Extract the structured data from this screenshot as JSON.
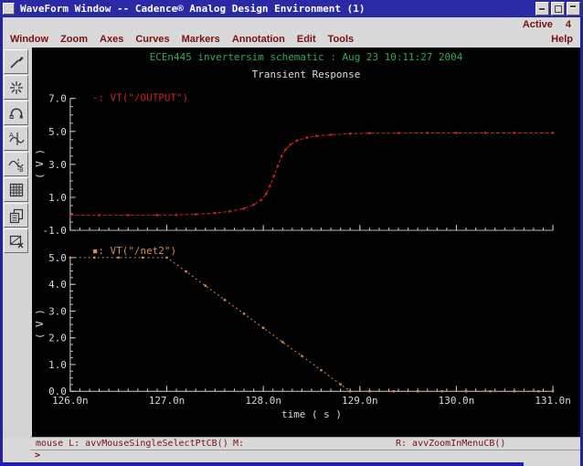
{
  "window": {
    "title": "WaveForm Window -- Cadence® Analog Design Environment (1)",
    "active_label": "Active",
    "active_count": "4"
  },
  "menu": {
    "items": [
      "Window",
      "Zoom",
      "Axes",
      "Curves",
      "Markers",
      "Annotation",
      "Edit",
      "Tools"
    ],
    "help": "Help"
  },
  "toolbar": {
    "icons": [
      "annotate-pen",
      "zoom-fit",
      "undo",
      "vertical-marker-a",
      "horizontal-marker-b",
      "calculator",
      "copy-graph",
      "slice-graph"
    ]
  },
  "status": {
    "mouse_left": "mouse L: avvMouseSingleSelectPtCB()",
    "mouse_middle": "M:",
    "mouse_right": "R: avvZoomInMenuCB()",
    "prompt": ">"
  },
  "colors": {
    "titlebar": "#2a2aa6",
    "menu_text": "#7a1010",
    "header_green": "#33a855",
    "axis_white": "#cccccc",
    "output_trace": "#cc2222",
    "net2_trace": "#d88a5a"
  },
  "chart_data": {
    "type": "line",
    "header": "ECEn445 invertersim schematic : Aug 23 10:11:27 2004",
    "title": "Transient Response",
    "xlabel": "time ( s )",
    "x_range_ns": [
      126,
      131
    ],
    "x_minor_step_ns": 0.1,
    "x_ticks": [
      {
        "v": 126,
        "label": "126.0n"
      },
      {
        "v": 127,
        "label": "127.0n"
      },
      {
        "v": 128,
        "label": "128.0n"
      },
      {
        "v": 129,
        "label": "129.0n"
      },
      {
        "v": 130,
        "label": "130.0n"
      },
      {
        "v": 131,
        "label": "131.0n"
      }
    ],
    "grid": false,
    "legend_position": "top-left-inside",
    "plots": [
      {
        "id": "top",
        "legend": "-: VT(\"/OUTPUT\")",
        "color": "#cc2222",
        "dash": "4 2",
        "ylabel": "( V )",
        "ylim": [
          -1.0,
          7.0
        ],
        "y_minor_step": 0.5,
        "yticks": [
          {
            "v": 7.0,
            "label": "7.0"
          },
          {
            "v": 5.0,
            "label": "5.0"
          },
          {
            "v": 3.0,
            "label": "3.0"
          },
          {
            "v": 1.0,
            "label": "1.0"
          },
          {
            "v": -1.0,
            "label": "-1.0"
          }
        ],
        "x_labeled": false,
        "series": {
          "name": "VT(\"/OUTPUT\")",
          "points": [
            [
              126.0,
              -0.08
            ],
            [
              126.3,
              -0.08
            ],
            [
              126.6,
              -0.08
            ],
            [
              126.9,
              -0.08
            ],
            [
              127.1,
              -0.07
            ],
            [
              127.3,
              -0.03
            ],
            [
              127.5,
              0.05
            ],
            [
              127.65,
              0.15
            ],
            [
              127.8,
              0.32
            ],
            [
              127.9,
              0.55
            ],
            [
              127.98,
              0.85
            ],
            [
              128.03,
              1.2
            ],
            [
              128.07,
              1.7
            ],
            [
              128.11,
              2.3
            ],
            [
              128.15,
              2.9
            ],
            [
              128.19,
              3.5
            ],
            [
              128.23,
              3.9
            ],
            [
              128.28,
              4.2
            ],
            [
              128.35,
              4.45
            ],
            [
              128.45,
              4.62
            ],
            [
              128.55,
              4.72
            ],
            [
              128.7,
              4.8
            ],
            [
              128.9,
              4.86
            ],
            [
              129.1,
              4.89
            ],
            [
              129.4,
              4.9
            ],
            [
              129.7,
              4.91
            ],
            [
              130.0,
              4.91
            ],
            [
              130.3,
              4.91
            ],
            [
              130.6,
              4.91
            ],
            [
              131.0,
              4.91
            ]
          ]
        }
      },
      {
        "id": "bottom",
        "legend": "▪: VT(\"/net2\")",
        "color": "#d88a5a",
        "dash": "2 3",
        "ylabel": "( V )",
        "ylim": [
          0.0,
          5.0
        ],
        "y_minor_step": 0.25,
        "yticks": [
          {
            "v": 5.0,
            "label": "5.0"
          },
          {
            "v": 4.0,
            "label": "4.0"
          },
          {
            "v": 3.0,
            "label": "3.0"
          },
          {
            "v": 2.0,
            "label": "2.0"
          },
          {
            "v": 1.0,
            "label": "1.0"
          },
          {
            "v": 0.0,
            "label": "0.0"
          }
        ],
        "x_labeled": true,
        "series": {
          "name": "VT(\"/net2\")",
          "points": [
            [
              126.0,
              5.0
            ],
            [
              126.25,
              5.0
            ],
            [
              126.5,
              5.0
            ],
            [
              126.75,
              5.0
            ],
            [
              127.0,
              5.0
            ],
            [
              127.2,
              4.48
            ],
            [
              127.4,
              3.95
            ],
            [
              127.6,
              3.42
            ],
            [
              127.8,
              2.9
            ],
            [
              128.0,
              2.37
            ],
            [
              128.2,
              1.84
            ],
            [
              128.4,
              1.32
            ],
            [
              128.6,
              0.79
            ],
            [
              128.8,
              0.26
            ],
            [
              128.9,
              0.0
            ],
            [
              129.1,
              0.0
            ],
            [
              129.35,
              0.0
            ],
            [
              129.6,
              0.0
            ],
            [
              129.85,
              0.0
            ],
            [
              130.1,
              0.0
            ],
            [
              130.35,
              0.0
            ],
            [
              130.6,
              0.0
            ],
            [
              130.85,
              0.0
            ],
            [
              131.0,
              0.0
            ]
          ]
        }
      }
    ]
  }
}
